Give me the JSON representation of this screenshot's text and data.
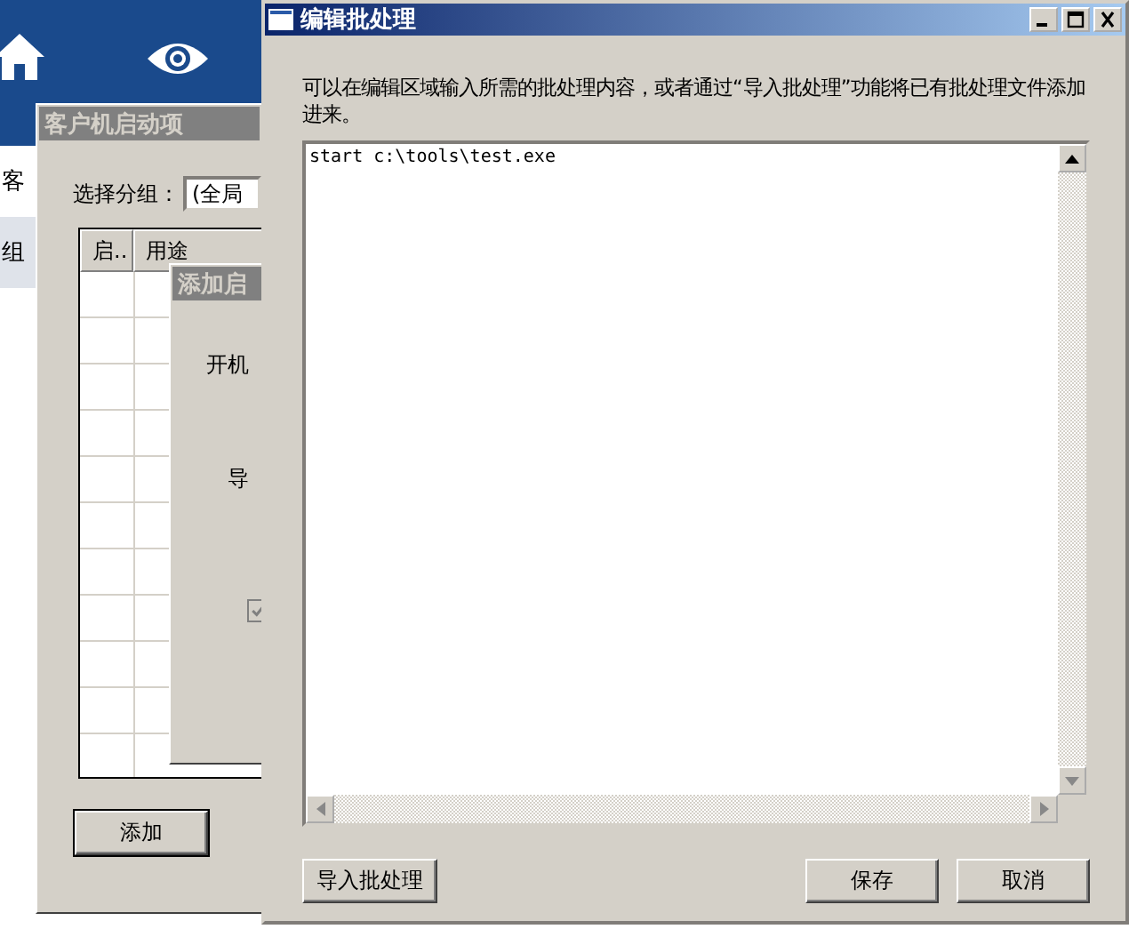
{
  "background_app": {
    "nav": [
      {
        "kind": "home"
      },
      {
        "kind": "eye"
      }
    ],
    "rows": [
      "客",
      "组"
    ]
  },
  "startup_window": {
    "title": "客户机启动项",
    "group_label": "选择分组：",
    "group_value": "(全局",
    "columns": [
      "启..",
      "用途"
    ],
    "buttons": [
      "添加"
    ]
  },
  "add_dialog": {
    "title": "添加启",
    "labels": [
      "开机",
      "导"
    ],
    "checkbox": {
      "checked": true,
      "disabled": true
    }
  },
  "editor": {
    "title": "编辑批处理",
    "description": "可以在编辑区域输入所需的批处理内容，或者通过“导入批处理”功能将已有批处理文件添加进来。",
    "content": "start c:\\tools\\test.exe",
    "buttons": [
      {
        "kind": "import",
        "label": "导入批处理"
      },
      {
        "kind": "save",
        "label": "保存"
      },
      {
        "kind": "cancel",
        "label": "取消"
      }
    ]
  }
}
